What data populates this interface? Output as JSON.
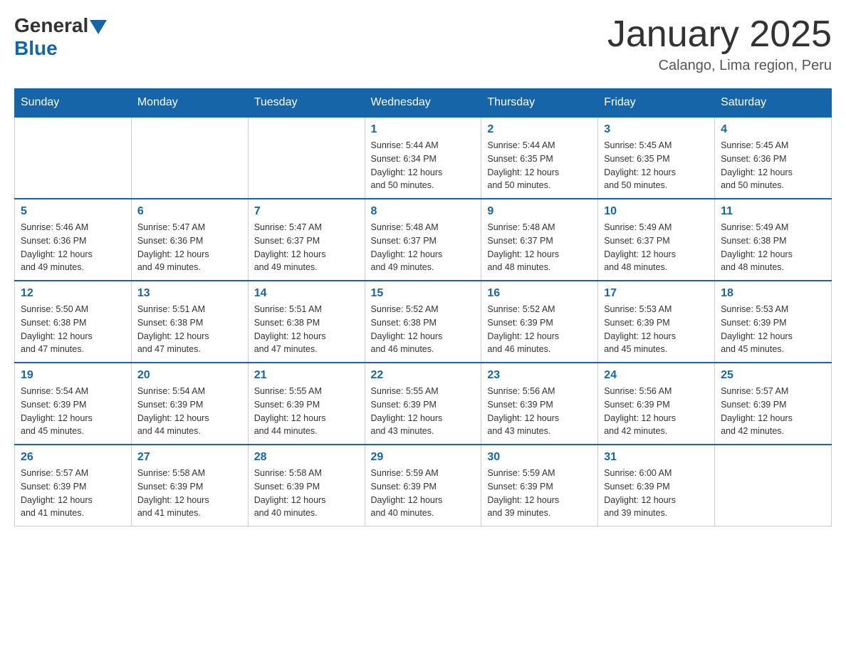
{
  "header": {
    "logo_general": "General",
    "logo_blue": "Blue",
    "month_year": "January 2025",
    "location": "Calango, Lima region, Peru"
  },
  "days_of_week": [
    "Sunday",
    "Monday",
    "Tuesday",
    "Wednesday",
    "Thursday",
    "Friday",
    "Saturday"
  ],
  "weeks": [
    [
      {
        "num": "",
        "info": ""
      },
      {
        "num": "",
        "info": ""
      },
      {
        "num": "",
        "info": ""
      },
      {
        "num": "1",
        "info": "Sunrise: 5:44 AM\nSunset: 6:34 PM\nDaylight: 12 hours\nand 50 minutes."
      },
      {
        "num": "2",
        "info": "Sunrise: 5:44 AM\nSunset: 6:35 PM\nDaylight: 12 hours\nand 50 minutes."
      },
      {
        "num": "3",
        "info": "Sunrise: 5:45 AM\nSunset: 6:35 PM\nDaylight: 12 hours\nand 50 minutes."
      },
      {
        "num": "4",
        "info": "Sunrise: 5:45 AM\nSunset: 6:36 PM\nDaylight: 12 hours\nand 50 minutes."
      }
    ],
    [
      {
        "num": "5",
        "info": "Sunrise: 5:46 AM\nSunset: 6:36 PM\nDaylight: 12 hours\nand 49 minutes."
      },
      {
        "num": "6",
        "info": "Sunrise: 5:47 AM\nSunset: 6:36 PM\nDaylight: 12 hours\nand 49 minutes."
      },
      {
        "num": "7",
        "info": "Sunrise: 5:47 AM\nSunset: 6:37 PM\nDaylight: 12 hours\nand 49 minutes."
      },
      {
        "num": "8",
        "info": "Sunrise: 5:48 AM\nSunset: 6:37 PM\nDaylight: 12 hours\nand 49 minutes."
      },
      {
        "num": "9",
        "info": "Sunrise: 5:48 AM\nSunset: 6:37 PM\nDaylight: 12 hours\nand 48 minutes."
      },
      {
        "num": "10",
        "info": "Sunrise: 5:49 AM\nSunset: 6:37 PM\nDaylight: 12 hours\nand 48 minutes."
      },
      {
        "num": "11",
        "info": "Sunrise: 5:49 AM\nSunset: 6:38 PM\nDaylight: 12 hours\nand 48 minutes."
      }
    ],
    [
      {
        "num": "12",
        "info": "Sunrise: 5:50 AM\nSunset: 6:38 PM\nDaylight: 12 hours\nand 47 minutes."
      },
      {
        "num": "13",
        "info": "Sunrise: 5:51 AM\nSunset: 6:38 PM\nDaylight: 12 hours\nand 47 minutes."
      },
      {
        "num": "14",
        "info": "Sunrise: 5:51 AM\nSunset: 6:38 PM\nDaylight: 12 hours\nand 47 minutes."
      },
      {
        "num": "15",
        "info": "Sunrise: 5:52 AM\nSunset: 6:38 PM\nDaylight: 12 hours\nand 46 minutes."
      },
      {
        "num": "16",
        "info": "Sunrise: 5:52 AM\nSunset: 6:39 PM\nDaylight: 12 hours\nand 46 minutes."
      },
      {
        "num": "17",
        "info": "Sunrise: 5:53 AM\nSunset: 6:39 PM\nDaylight: 12 hours\nand 45 minutes."
      },
      {
        "num": "18",
        "info": "Sunrise: 5:53 AM\nSunset: 6:39 PM\nDaylight: 12 hours\nand 45 minutes."
      }
    ],
    [
      {
        "num": "19",
        "info": "Sunrise: 5:54 AM\nSunset: 6:39 PM\nDaylight: 12 hours\nand 45 minutes."
      },
      {
        "num": "20",
        "info": "Sunrise: 5:54 AM\nSunset: 6:39 PM\nDaylight: 12 hours\nand 44 minutes."
      },
      {
        "num": "21",
        "info": "Sunrise: 5:55 AM\nSunset: 6:39 PM\nDaylight: 12 hours\nand 44 minutes."
      },
      {
        "num": "22",
        "info": "Sunrise: 5:55 AM\nSunset: 6:39 PM\nDaylight: 12 hours\nand 43 minutes."
      },
      {
        "num": "23",
        "info": "Sunrise: 5:56 AM\nSunset: 6:39 PM\nDaylight: 12 hours\nand 43 minutes."
      },
      {
        "num": "24",
        "info": "Sunrise: 5:56 AM\nSunset: 6:39 PM\nDaylight: 12 hours\nand 42 minutes."
      },
      {
        "num": "25",
        "info": "Sunrise: 5:57 AM\nSunset: 6:39 PM\nDaylight: 12 hours\nand 42 minutes."
      }
    ],
    [
      {
        "num": "26",
        "info": "Sunrise: 5:57 AM\nSunset: 6:39 PM\nDaylight: 12 hours\nand 41 minutes."
      },
      {
        "num": "27",
        "info": "Sunrise: 5:58 AM\nSunset: 6:39 PM\nDaylight: 12 hours\nand 41 minutes."
      },
      {
        "num": "28",
        "info": "Sunrise: 5:58 AM\nSunset: 6:39 PM\nDaylight: 12 hours\nand 40 minutes."
      },
      {
        "num": "29",
        "info": "Sunrise: 5:59 AM\nSunset: 6:39 PM\nDaylight: 12 hours\nand 40 minutes."
      },
      {
        "num": "30",
        "info": "Sunrise: 5:59 AM\nSunset: 6:39 PM\nDaylight: 12 hours\nand 39 minutes."
      },
      {
        "num": "31",
        "info": "Sunrise: 6:00 AM\nSunset: 6:39 PM\nDaylight: 12 hours\nand 39 minutes."
      },
      {
        "num": "",
        "info": ""
      }
    ]
  ]
}
